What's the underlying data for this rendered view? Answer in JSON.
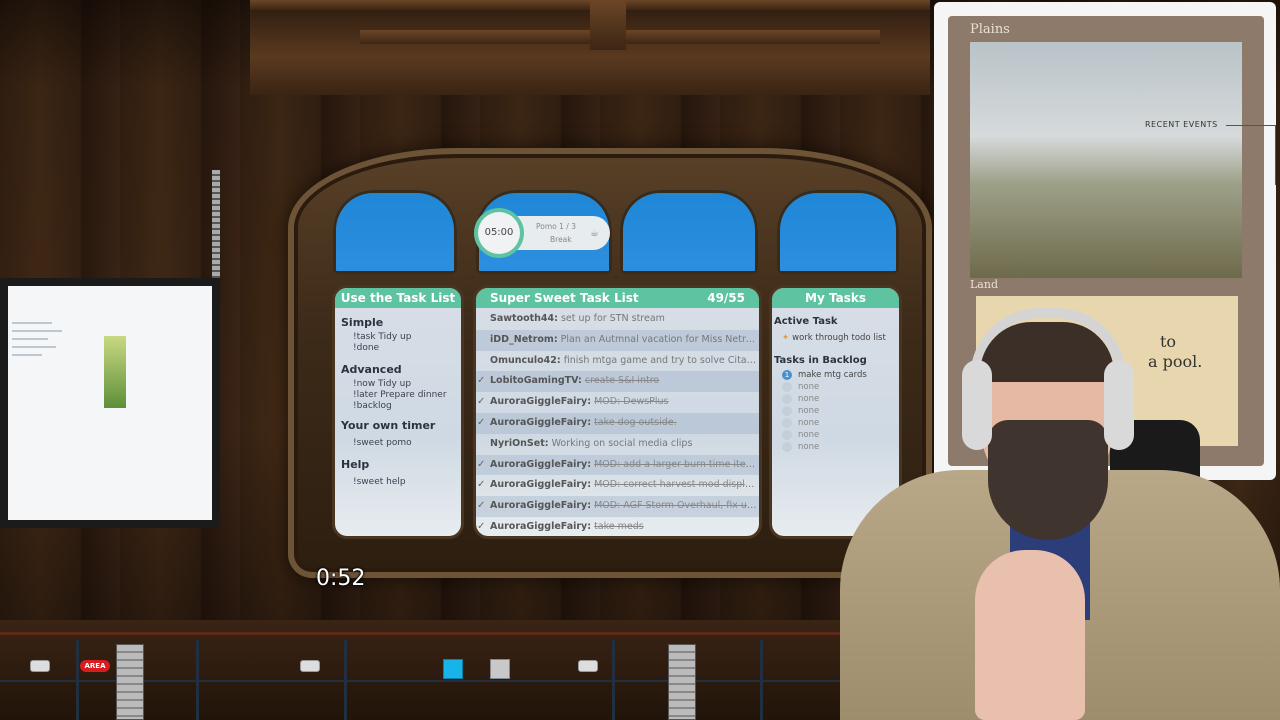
{
  "timer": "0:52",
  "pomo": {
    "time": "05:00",
    "label": "Pomo  1 / 3",
    "status": "Break",
    "icon": "coffee-cup-icon"
  },
  "help_panel": {
    "title": "Use the Task List",
    "sections": [
      {
        "title": "Simple",
        "commands": [
          "!task Tidy up",
          "!done"
        ]
      },
      {
        "title": "Advanced",
        "commands": [
          "!now Tidy up",
          "!later Prepare dinner",
          "!backlog"
        ]
      },
      {
        "title": "Your own timer",
        "commands": [
          "!sweet pomo"
        ]
      },
      {
        "title": "Help",
        "commands": [
          "!sweet help"
        ]
      }
    ]
  },
  "task_list": {
    "title": "Super Sweet Task List",
    "count": "49/55",
    "rows": [
      {
        "user": "Sawtooth44:",
        "text": "set up for STN stream",
        "done": false
      },
      {
        "user": "iDD_Netrom:",
        "text": "Plan an Autmnal vacation for Miss Netro...",
        "done": false
      },
      {
        "user": "Omunculo42:",
        "text": "finish mtga game and try to solve Citad...",
        "done": false
      },
      {
        "user": "LobitoGamingTV:",
        "text": "create S&I intro",
        "done": true
      },
      {
        "user": "AuroraGiggleFairy:",
        "text": "MOD: DewsPlus",
        "done": true
      },
      {
        "user": "AuroraGiggleFairy:",
        "text": "take dog outside.",
        "done": true
      },
      {
        "user": "NyriOnSet:",
        "text": "Working on social media clips",
        "done": false
      },
      {
        "user": "AuroraGiggleFairy:",
        "text": "MOD: add a larger burn time item f...",
        "done": true
      },
      {
        "user": "AuroraGiggleFairy:",
        "text": "MOD: correct harvest mod display ...",
        "done": true
      },
      {
        "user": "AuroraGiggleFairy:",
        "text": "MOD: AGF Storm Overhaul, fix up t...",
        "done": true
      },
      {
        "user": "AuroraGiggleFairy:",
        "text": "take meds",
        "done": true
      }
    ]
  },
  "my_tasks": {
    "title": "My Tasks",
    "active_title": "Active Task",
    "active_task": "work through todo list",
    "backlog_title": "Tasks in Backlog",
    "backlog": [
      {
        "num": "1",
        "text": "make mtg cards"
      },
      {
        "num": "",
        "text": "none"
      },
      {
        "num": "",
        "text": "none"
      },
      {
        "num": "",
        "text": "none"
      },
      {
        "num": "",
        "text": "none"
      },
      {
        "num": "",
        "text": "none"
      },
      {
        "num": "",
        "text": "none"
      }
    ]
  },
  "card": {
    "name": "Plains",
    "type": "Land",
    "text_line1": "to",
    "text_line2": "a pool."
  },
  "recent_events": "RECENT EVENTS",
  "area_sign": "AREA",
  "colors": {
    "accent": "#5ec3a1",
    "sky": "#2d8fe0"
  }
}
